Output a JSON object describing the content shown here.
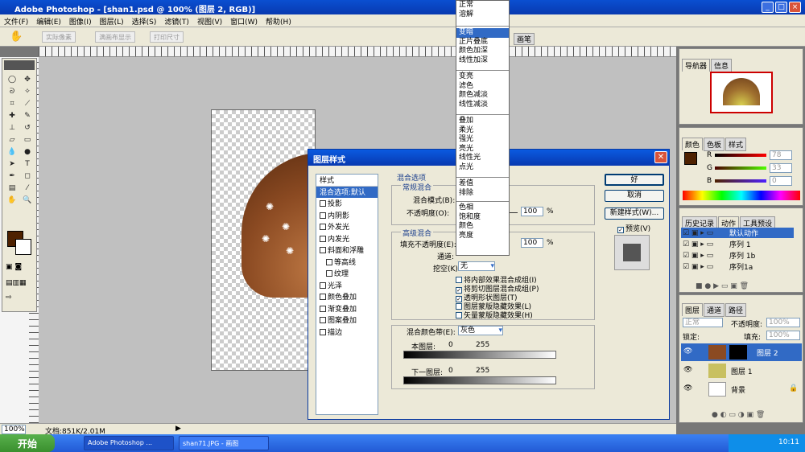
{
  "window": {
    "title": "Adobe Photoshop - [shan1.psd @ 100% (图层 2, RGB)]"
  },
  "menu": [
    "文件(F)",
    "编辑(E)",
    "图像(I)",
    "图层(L)",
    "选择(S)",
    "滤镜(T)",
    "视图(V)",
    "窗口(W)",
    "帮助(H)"
  ],
  "options": [
    "实际像素",
    "满画布显示",
    "打印尺寸"
  ],
  "dialog": {
    "title": "图层样式",
    "styles": [
      {
        "label": "样式",
        "check": false,
        "sel": false
      },
      {
        "label": "混合选项:默认",
        "check": false,
        "sel": true
      },
      {
        "label": "投影",
        "check": true
      },
      {
        "label": "内阴影",
        "check": true
      },
      {
        "label": "外发光",
        "check": true
      },
      {
        "label": "内发光",
        "check": true
      },
      {
        "label": "斜面和浮雕",
        "check": true
      },
      {
        "label": "等高线",
        "check": true,
        "indent": true
      },
      {
        "label": "纹理",
        "check": true,
        "indent": true
      },
      {
        "label": "光泽",
        "check": true
      },
      {
        "label": "颜色叠加",
        "check": true
      },
      {
        "label": "渐变叠加",
        "check": true
      },
      {
        "label": "图案叠加",
        "check": true
      },
      {
        "label": "描边",
        "check": true
      }
    ],
    "blend_options_title": "混合选项",
    "general_title": "常规混合",
    "blend_mode_label": "混合模式(B):",
    "opacity_label": "不透明度(O):",
    "opacity_value": "100",
    "percent": "%",
    "advanced_title": "高级混合",
    "fill_opacity_label": "填充不透明度(E):",
    "fill_opacity_value": "100",
    "channels_label": "通道:",
    "knockout_label": "挖空(K):",
    "knockout_value": "无",
    "checks": [
      {
        "label": "将内部效果混合成组(I)",
        "checked": false
      },
      {
        "label": "将剪切图层混合成组(P)",
        "checked": true
      },
      {
        "label": "透明形状图层(T)",
        "checked": true
      },
      {
        "label": "图层蒙版隐藏效果(L)",
        "checked": false
      },
      {
        "label": "矢量蒙版隐藏效果(H)",
        "checked": false
      }
    ],
    "blend_if_label": "混合颜色带(E):",
    "blend_if_value": "灰色",
    "this_layer": "本图层:",
    "underlying_layer": "下一图层:",
    "zero": "0",
    "max": "255",
    "ok": "好",
    "cancel": "取消",
    "new_style": "新建样式(W)...",
    "preview": "预览(V)"
  },
  "blend_modes": [
    [
      "正常",
      "溶解"
    ],
    [
      "变暗",
      "正片叠底",
      "颜色加深",
      "线性加深"
    ],
    [
      "变亮",
      "滤色",
      "颜色减淡",
      "线性减淡"
    ],
    [
      "叠加",
      "柔光",
      "强光",
      "亮光",
      "线性光",
      "点光"
    ],
    [
      "差值",
      "排除"
    ],
    [
      "色相",
      "饱和度",
      "颜色",
      "亮度"
    ]
  ],
  "selected_mode": "变暗",
  "doc_tabs": [
    "画笔"
  ],
  "navigator": {
    "tabs": [
      "导航器",
      "信息"
    ]
  },
  "color_panel": {
    "tabs": [
      "颜色",
      "色板",
      "样式"
    ],
    "R": "78",
    "G": "33",
    "B": "0"
  },
  "history": {
    "tabs": [
      "历史记录",
      "动作",
      "工具预设"
    ],
    "items": [
      "默认动作",
      "序列 1",
      "序列 1b",
      "序列1a"
    ]
  },
  "layers": {
    "tabs": [
      "图层",
      "通道",
      "路径"
    ],
    "mode": "正常",
    "opacity_label": "不透明度:",
    "opacity": "100%",
    "lock_label": "锁定:",
    "fill_label": "填充:",
    "fill": "100%",
    "items": [
      "图层 2",
      "图层 1",
      "背景"
    ]
  },
  "status": {
    "zoom": "100%",
    "doc": "文档:851K/2.01M"
  },
  "taskbar": {
    "start": "开始",
    "tasks": [
      "Adobe Photoshop ...",
      "shan71.JPG - 画图"
    ],
    "time": "10:11"
  }
}
